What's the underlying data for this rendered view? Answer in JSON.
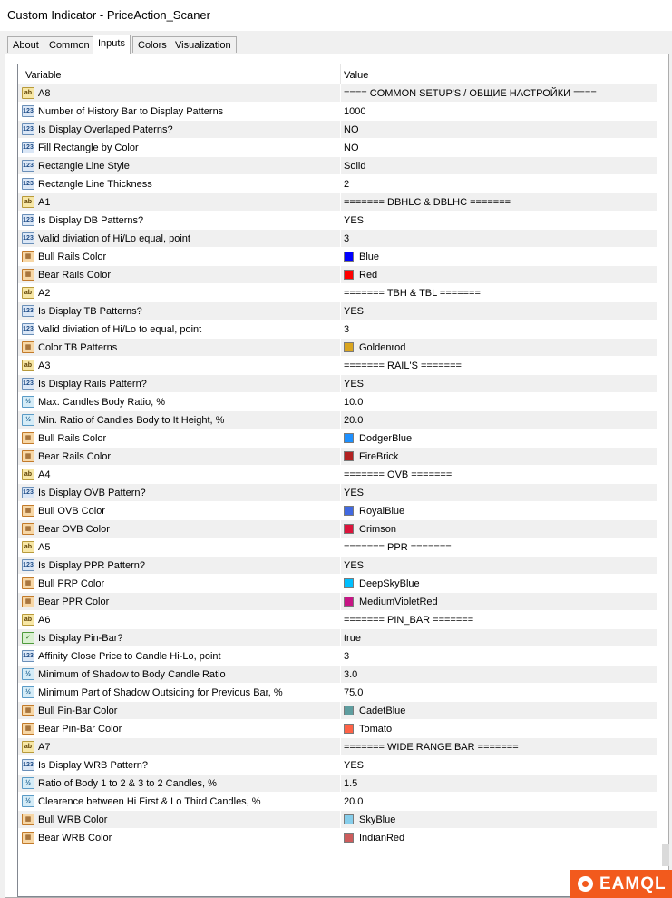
{
  "window": {
    "title": "Custom Indicator - PriceAction_Scaner"
  },
  "tabs": [
    {
      "label": "About"
    },
    {
      "label": "Common"
    },
    {
      "label": "Inputs"
    },
    {
      "label": "Colors"
    },
    {
      "label": "Visualization"
    }
  ],
  "active_tab": "Inputs",
  "columns": {
    "variable": "Variable",
    "value": "Value"
  },
  "rows": [
    {
      "type": "ab",
      "name": "A8",
      "value": "==== COMMON SETUP'S / ОБЩИЕ НАСТРОЙКИ ===="
    },
    {
      "type": "num",
      "name": "Number of History Bar to Display Patterns",
      "value": "1000"
    },
    {
      "type": "num",
      "name": "Is Display Overlaped Paterns?",
      "value": "NO"
    },
    {
      "type": "num",
      "name": "Fill Rectangle by Color",
      "value": "NO"
    },
    {
      "type": "num",
      "name": "Rectangle Line Style",
      "value": "Solid"
    },
    {
      "type": "num",
      "name": "Rectangle Line Thickness",
      "value": "2"
    },
    {
      "type": "ab",
      "name": "A1",
      "value": "======= DBHLC & DBLHC ======="
    },
    {
      "type": "num",
      "name": "Is Display DB Patterns?",
      "value": "YES"
    },
    {
      "type": "num",
      "name": "Valid diviation of Hi/Lo equal, point",
      "value": "3"
    },
    {
      "type": "color",
      "name": "Bull Rails Color",
      "value": "Blue",
      "swatch": "#0000ff"
    },
    {
      "type": "color",
      "name": "Bear Rails Color",
      "value": "Red",
      "swatch": "#ff0000"
    },
    {
      "type": "ab",
      "name": "A2",
      "value": "======= TBH & TBL ======="
    },
    {
      "type": "num",
      "name": "Is Display TB Patterns?",
      "value": "YES"
    },
    {
      "type": "num",
      "name": "Valid diviation of Hi/Lo to equal, point",
      "value": "3"
    },
    {
      "type": "color",
      "name": "Color TB Patterns",
      "value": "Goldenrod",
      "swatch": "#daa520"
    },
    {
      "type": "ab",
      "name": "A3",
      "value": "======= RAIL'S ======="
    },
    {
      "type": "num",
      "name": "Is Display Rails Pattern?",
      "value": "YES"
    },
    {
      "type": "frac",
      "name": "Max. Candles Body Ratio, %",
      "value": "10.0"
    },
    {
      "type": "frac",
      "name": "Min. Ratio of Candles Body to It Height, %",
      "value": "20.0"
    },
    {
      "type": "color",
      "name": "Bull Rails Color",
      "value": "DodgerBlue",
      "swatch": "#1e90ff"
    },
    {
      "type": "color",
      "name": "Bear Rails Color",
      "value": "FireBrick",
      "swatch": "#b22222"
    },
    {
      "type": "ab",
      "name": "A4",
      "value": "======= OVB  ======="
    },
    {
      "type": "num",
      "name": "Is Display OVB Pattern?",
      "value": "YES"
    },
    {
      "type": "color",
      "name": "Bull OVB Color",
      "value": "RoyalBlue",
      "swatch": "#4169e1"
    },
    {
      "type": "color",
      "name": "Bear OVB Color",
      "value": "Crimson",
      "swatch": "#dc143c"
    },
    {
      "type": "ab",
      "name": "A5",
      "value": "======= PPR  ======="
    },
    {
      "type": "num",
      "name": "Is Display PPR Pattern?",
      "value": "YES"
    },
    {
      "type": "color",
      "name": "Bull PRP Color",
      "value": "DeepSkyBlue",
      "swatch": "#00bfff"
    },
    {
      "type": "color",
      "name": "Bear PPR Color",
      "value": "MediumVioletRed",
      "swatch": "#c71585"
    },
    {
      "type": "ab",
      "name": "A6",
      "value": "======= PIN_BAR  ======="
    },
    {
      "type": "bool",
      "name": "Is Display Pin-Bar?",
      "value": "true"
    },
    {
      "type": "num",
      "name": "Affinity Close Price to Candle Hi-Lo, point",
      "value": "3"
    },
    {
      "type": "frac",
      "name": "Minimum of Shadow to Body Candle Ratio",
      "value": "3.0"
    },
    {
      "type": "frac",
      "name": "Minimum Part of Shadow Outsiding for Previous Bar, %",
      "value": "75.0"
    },
    {
      "type": "color",
      "name": "Bull Pin-Bar Color",
      "value": "CadetBlue",
      "swatch": "#5f9ea0"
    },
    {
      "type": "color",
      "name": "Bear Pin-Bar Color",
      "value": "Tomato",
      "swatch": "#ff6347"
    },
    {
      "type": "ab",
      "name": "A7",
      "value": "======= WIDE RANGE BAR ======="
    },
    {
      "type": "num",
      "name": "Is Display WRB Pattern?",
      "value": "YES"
    },
    {
      "type": "frac",
      "name": "Ratio of Body 1 to 2 & 3 to 2 Candles, %",
      "value": "1.5"
    },
    {
      "type": "frac",
      "name": "Clearence between Hi First & Lo Third Candles, %",
      "value": "20.0"
    },
    {
      "type": "color",
      "name": "Bull WRB Color",
      "value": "SkyBlue",
      "swatch": "#87ceeb"
    },
    {
      "type": "color",
      "name": "Bear WRB Color",
      "value": "IndianRed",
      "swatch": "#cd5c5c"
    }
  ],
  "icon_glyphs": {
    "ab": "ab",
    "num": "123",
    "frac": "½",
    "bool": "✓",
    "color": "▦"
  },
  "logo": {
    "text": "EAMQL"
  }
}
